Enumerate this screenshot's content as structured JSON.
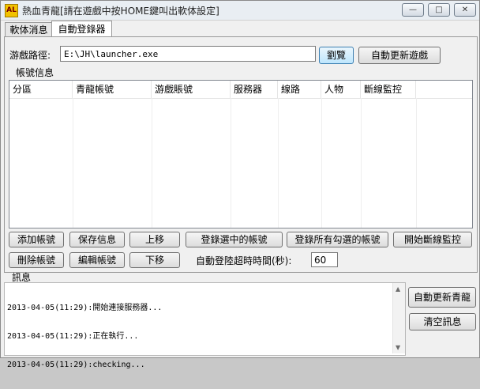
{
  "window": {
    "title": "熱血青龍[請在遊戲中按HOME鍵叫出軟体設定]",
    "icon": "app-logo-icon"
  },
  "tabs": [
    {
      "label": "軟体消息"
    },
    {
      "label": "自動登錄器"
    }
  ],
  "path": {
    "label": "游戲路徑:",
    "value": "E:\\JH\\launcher.exe",
    "browse_label": "劉覽",
    "update_label": "自動更新遊戲"
  },
  "accounts": {
    "section_label": "帳號信息",
    "columns": [
      "分區",
      "青龍帳號",
      "游戲賬號",
      "服務器",
      "線路",
      "人物",
      "斷線監控"
    ]
  },
  "buttons": {
    "add": "添加帳號",
    "save": "保存信息",
    "move_up": "上移",
    "login_selected": "登錄選中的帳號",
    "login_all": "登錄所有勾選的帳號",
    "start_monitor": "開始斷線監控",
    "delete": "刪除帳號",
    "edit": "編輯帳號",
    "move_down": "下移"
  },
  "timeout": {
    "label": "自動登陸超時時間(秒):",
    "value": "60"
  },
  "log": {
    "section_label": "訊息",
    "lines": [
      "2013-04-05(11:29):開始連接服務器...",
      "2013-04-05(11:29):正在執行...",
      "2013-04-05(11:29):checking..."
    ],
    "auto_update_label": "自動更新青龍",
    "clear_label": "清空訊息"
  }
}
